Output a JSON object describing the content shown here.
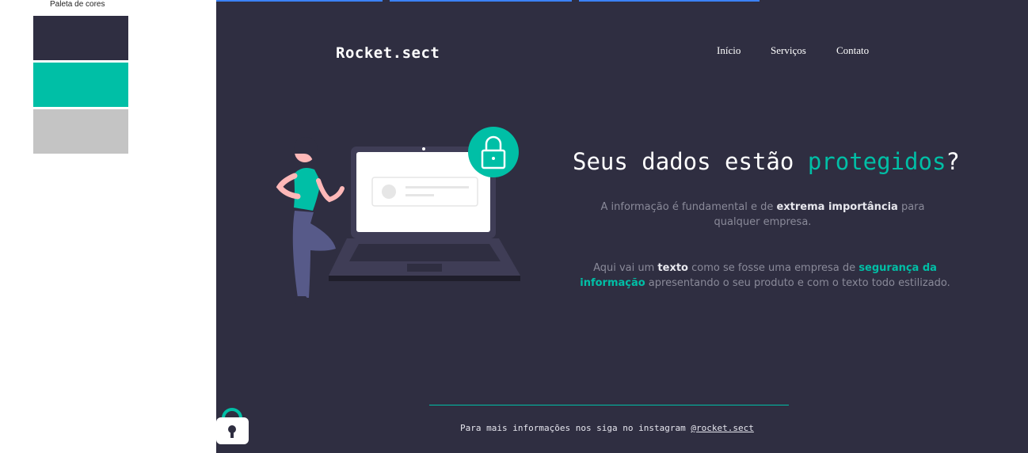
{
  "palette": {
    "title": "Paleta de cores",
    "colors": [
      "#2f2e41",
      "#00bfa6",
      "#c4c4c4"
    ]
  },
  "header": {
    "logo": "Rocket.sect",
    "nav": [
      "Início",
      "Serviços",
      "Contato"
    ]
  },
  "hero": {
    "headline_prefix": "Seus dados estão ",
    "headline_accent": "protegidos",
    "headline_suffix": "?",
    "p1_a": "A informação é fundamental e de ",
    "p1_b": "extrema importância",
    "p1_c": " para qualquer empresa.",
    "p2_a": "Aqui vai um ",
    "p2_b": "texto",
    "p2_c": " como se fosse uma empresa de ",
    "p2_d": "segurança da informação",
    "p2_e": " apresentando o seu produto e com o texto todo estilizado."
  },
  "footer": {
    "text": "Para mais informações nos siga no instagram ",
    "handle": "@rocket.sect"
  },
  "colors": {
    "accent": "#00bfa6",
    "background": "#2f2e41"
  },
  "icons": [
    "padlock-icon",
    "laptop-illustration",
    "woman-illustration",
    "padlock-button-icon"
  ]
}
